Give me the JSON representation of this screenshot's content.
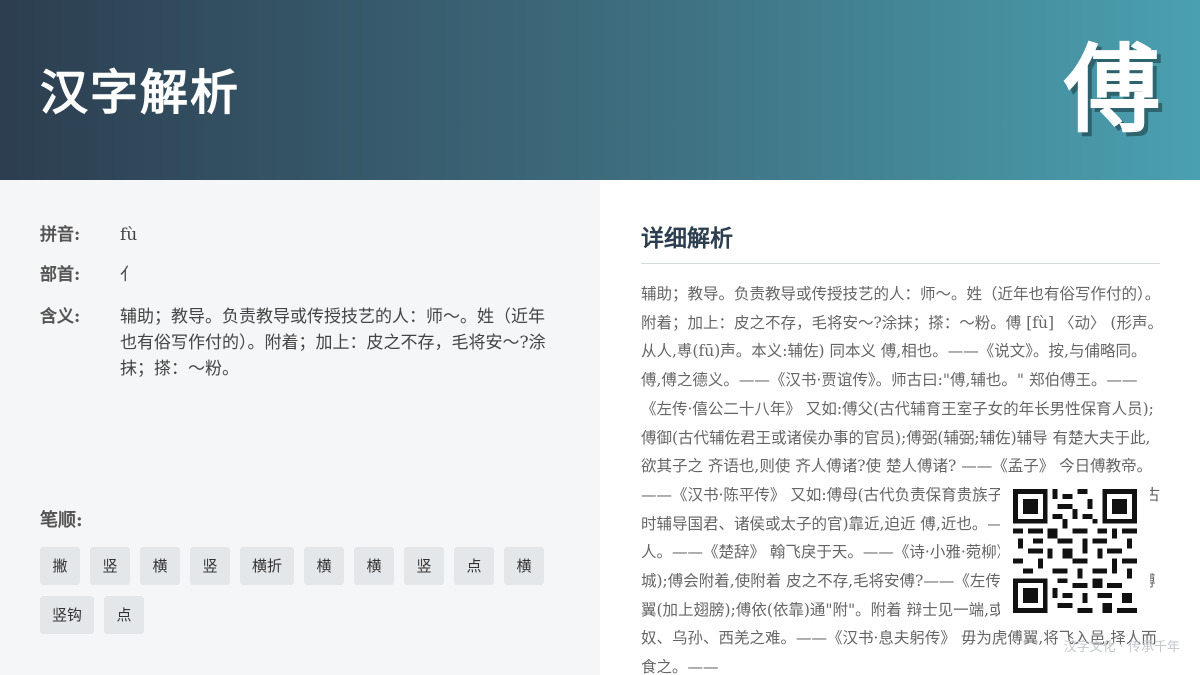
{
  "header": {
    "title": "汉字解析",
    "character": "傅"
  },
  "info": {
    "pinyin_label": "拼音:",
    "pinyin": "fù",
    "radical_label": "部首:",
    "radical": "亻",
    "meaning_label": "含义:",
    "meaning": "辅助；教导。负责教导或传授技艺的人：师～。姓（近年也有俗写作付的）。附着；加上：皮之不存，毛将安～?涂抹；搽：～粉。"
  },
  "strokes": {
    "label": "笔顺:",
    "items": [
      "撇",
      "竖",
      "横",
      "竖",
      "横折",
      "横",
      "横",
      "竖",
      "点",
      "横",
      "竖钩",
      "点"
    ]
  },
  "detail": {
    "title": "详细解析",
    "text": "辅助；教导。负责教导或传授技艺的人：师～。姓（近年也有俗写作付的）。附着；加上：皮之不存，毛将安～?涂抹；搽：～粉。傅 [fù] 〈动〉 (形声。从人,尃(fū)声。本义:辅佐) 同本义 傅,相也。——《说文》。按,与俌略同。 傅,傅之德义。——《汉书·贾谊传》。师古曰:\"傅,辅也。\" 郑伯傅王。——《左传·僖公二十八年》 又如:傅父(古代辅育王室子女的年长男性保育人员);傅御(古代辅佐君王或诸侯办事的官员);傅弼(辅弼;辅佐)辅导 有楚大夫于此,欲其子之 齐语也,则使 齐人傅诸?使 楚人傅诸? ——《孟子》 今日傅教帝。——《汉书·陈平传》 又如:傅母(古代负责保育贵族子女的年老妇人);傅相(古时辅导国君、诸侯或太子的官)靠近,迫近 傅,近也。——《小尔雅》 重欲傅人。——《楚辞》 翰飞戾于天。——《诗·小雅·菀柳》 又如:傅郭(靠近外城);傅会附着,使附着 皮之不存,毛将安傅?——《左传·僖公十四年》 又如:傅翼(加上翅膀);傅依(依靠)通\"附\"。附着 辩士见一端,或以意傅着星历,虚造匈奴、乌孙、西羌之难。——《汉书·息夫躬传》 毋为虎傅翼,将飞入邑,择人而食之。——"
  },
  "watermark": "汉字文化 · 传承千年"
}
